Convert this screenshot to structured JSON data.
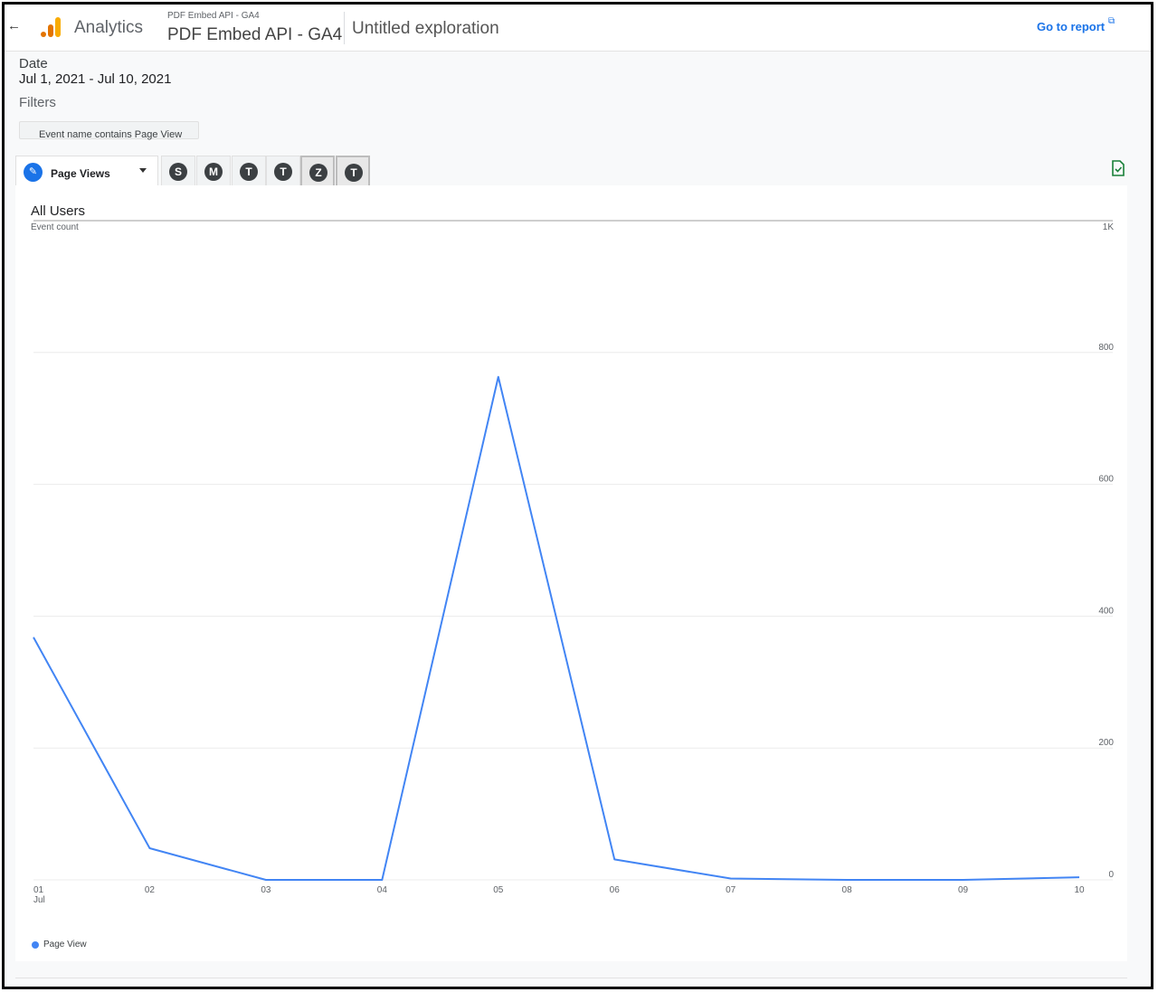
{
  "header": {
    "app_name": "Analytics",
    "property_small": "PDF Embed API - GA4",
    "property_big": "PDF Embed API - GA4",
    "exploration_title": "Untitled exploration",
    "go_to_report": "Go to report"
  },
  "variables": {
    "date_label": "Date",
    "date_range": "Jul 1, 2021 - Jul 10, 2021",
    "filters_label": "Filters",
    "filter_chip": "Event name contains Page View"
  },
  "tabs": {
    "main_label": "Page Views",
    "segments": [
      "S",
      "M",
      "T",
      "T",
      "Z",
      "T"
    ]
  },
  "panel": {
    "title": "All Users",
    "subtitle": "Event count",
    "legend": "Page View"
  },
  "colors": {
    "accent": "#1a73e8",
    "series": "#4285f4"
  },
  "chart_data": {
    "type": "line",
    "title": "All Users",
    "ylabel": "Event count",
    "xlabel": "",
    "x": [
      "01",
      "02",
      "03",
      "04",
      "05",
      "06",
      "07",
      "08",
      "09",
      "10"
    ],
    "x_sublabel_first": "Jul",
    "ylim": [
      0,
      1000
    ],
    "y_ticks": [
      "0",
      "200",
      "400",
      "600",
      "800",
      "1K"
    ],
    "y_tick_values": [
      0,
      200,
      400,
      600,
      800,
      1000
    ],
    "grid": true,
    "legend_position": "bottom-left",
    "series": [
      {
        "name": "Page View",
        "values": [
          368,
          48,
          0,
          0,
          763,
          31,
          2,
          0,
          0,
          4
        ]
      }
    ]
  }
}
